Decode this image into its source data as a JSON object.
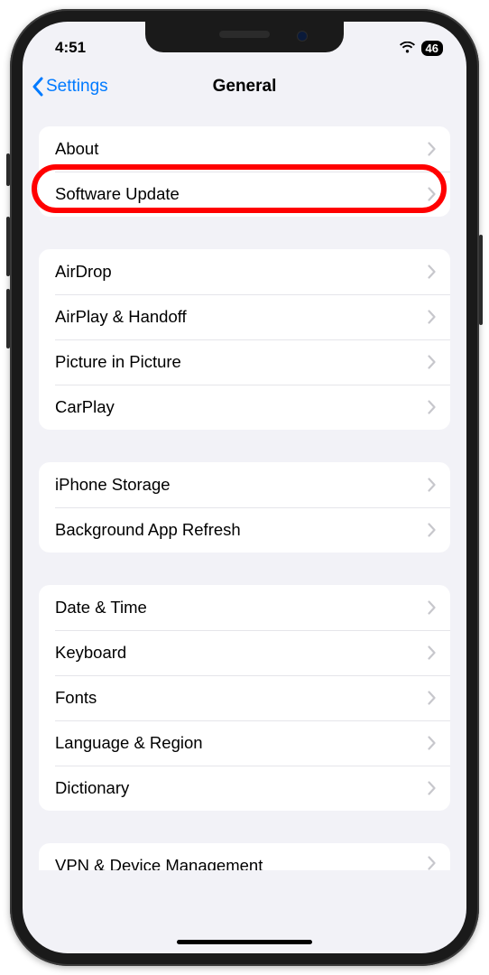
{
  "statusBar": {
    "time": "4:51",
    "batteryPercent": "46"
  },
  "nav": {
    "backLabel": "Settings",
    "title": "General"
  },
  "groups": [
    {
      "items": [
        {
          "key": "about",
          "label": "About"
        },
        {
          "key": "software-update",
          "label": "Software Update",
          "highlighted": true
        }
      ]
    },
    {
      "items": [
        {
          "key": "airdrop",
          "label": "AirDrop"
        },
        {
          "key": "airplay-handoff",
          "label": "AirPlay & Handoff"
        },
        {
          "key": "picture-in-picture",
          "label": "Picture in Picture"
        },
        {
          "key": "carplay",
          "label": "CarPlay"
        }
      ]
    },
    {
      "items": [
        {
          "key": "iphone-storage",
          "label": "iPhone Storage"
        },
        {
          "key": "background-app-refresh",
          "label": "Background App Refresh"
        }
      ]
    },
    {
      "items": [
        {
          "key": "date-time",
          "label": "Date & Time"
        },
        {
          "key": "keyboard",
          "label": "Keyboard"
        },
        {
          "key": "fonts",
          "label": "Fonts"
        },
        {
          "key": "language-region",
          "label": "Language & Region"
        },
        {
          "key": "dictionary",
          "label": "Dictionary"
        }
      ]
    }
  ],
  "cutoffRow": {
    "label": "VPN & Device Management"
  },
  "annotation": {
    "highlightColor": "#ff0000"
  }
}
